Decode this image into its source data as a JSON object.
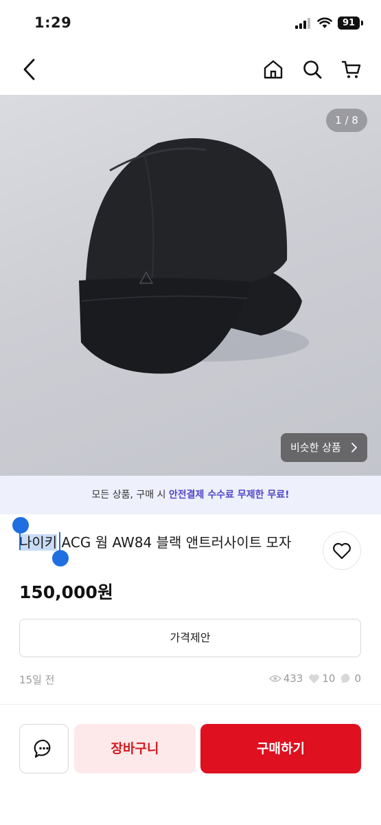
{
  "status_bar": {
    "time": "1:29",
    "battery": "91"
  },
  "nav": {
    "back_icon": "chevron-left-icon",
    "home_icon": "home-icon",
    "search_icon": "search-icon",
    "cart_icon": "cart-icon"
  },
  "gallery": {
    "counter": "1 / 8",
    "similar_label": "비슷한 상품"
  },
  "promo": {
    "prefix": "모든 상품, 구매 시 ",
    "highlight": "안전결제 수수료 무제한 무료!"
  },
  "product": {
    "title_selected": "나이키",
    "title_rest": " ACG 웜 AW84 블랙 앤트러사이트 모자",
    "price": "150,000원",
    "posted": "15일 전",
    "views": "433",
    "likes": "10",
    "chats": "0"
  },
  "actions": {
    "offer_label": "가격제안",
    "cart_label": "장바구니",
    "buy_label": "구매하기"
  },
  "colors": {
    "accent": "#df1020",
    "promo_accent": "#4f46c8",
    "selection": "#1f6fe0"
  }
}
